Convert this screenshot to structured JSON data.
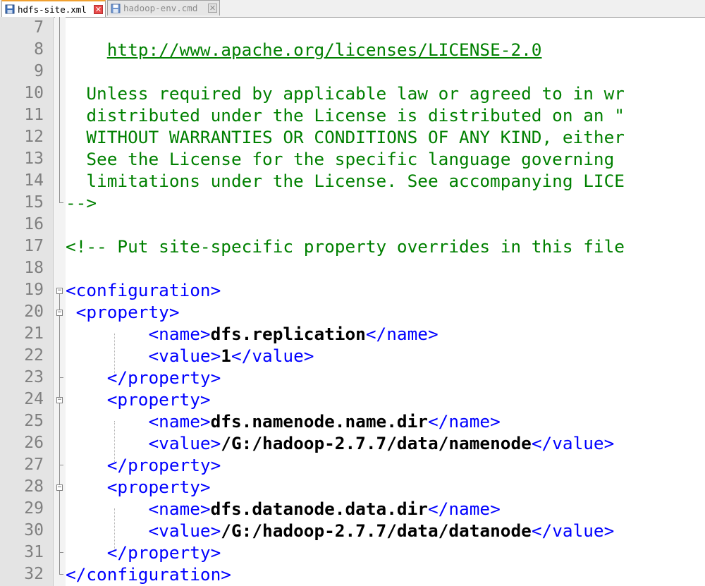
{
  "tabs": [
    {
      "name": "hdfs-site.xml",
      "active": true
    },
    {
      "name": "hadoop-env.cmd",
      "active": false
    }
  ],
  "colors": {
    "comment": "#008000",
    "tag": "#0000ff",
    "text": "#000000",
    "line_number": "#7f7f7f",
    "gutter_bg": "#e4e4e4"
  },
  "lines": [
    {
      "n": "7",
      "segs": []
    },
    {
      "n": "8",
      "segs": [
        {
          "c": "c",
          "t": "    "
        },
        {
          "c": "lnk",
          "t": "http://www.apache.org/licenses/LICENSE-2.0"
        }
      ]
    },
    {
      "n": "9",
      "segs": []
    },
    {
      "n": "10",
      "segs": [
        {
          "c": "c",
          "t": "  Unless required by applicable law or agreed to in wr"
        }
      ]
    },
    {
      "n": "11",
      "segs": [
        {
          "c": "c",
          "t": "  distributed under the License is distributed on an \""
        }
      ]
    },
    {
      "n": "12",
      "segs": [
        {
          "c": "c",
          "t": "  WITHOUT WARRANTIES OR CONDITIONS OF ANY KIND, either"
        }
      ]
    },
    {
      "n": "13",
      "segs": [
        {
          "c": "c",
          "t": "  See the License for the specific language governing"
        }
      ]
    },
    {
      "n": "14",
      "segs": [
        {
          "c": "c",
          "t": "  limitations under the License. See accompanying LICE"
        }
      ]
    },
    {
      "n": "15",
      "segs": [
        {
          "c": "c",
          "t": "-->"
        }
      ]
    },
    {
      "n": "16",
      "segs": []
    },
    {
      "n": "17",
      "segs": [
        {
          "c": "c",
          "t": "<!-- Put site-specific property overrides in this file"
        }
      ]
    },
    {
      "n": "18",
      "segs": []
    },
    {
      "n": "19",
      "segs": [
        {
          "c": "t",
          "t": "<configuration>"
        }
      ]
    },
    {
      "n": "20",
      "segs": [
        {
          "c": "t",
          "t": " <property>"
        }
      ]
    },
    {
      "n": "21",
      "segs": [
        {
          "c": "t",
          "t": "        <name>"
        },
        {
          "c": "b",
          "t": "dfs.replication"
        },
        {
          "c": "t",
          "t": "</name>"
        }
      ]
    },
    {
      "n": "22",
      "segs": [
        {
          "c": "t",
          "t": "        <value>"
        },
        {
          "c": "b",
          "t": "1"
        },
        {
          "c": "t",
          "t": "</value>"
        }
      ]
    },
    {
      "n": "23",
      "segs": [
        {
          "c": "t",
          "t": "    </property>"
        }
      ]
    },
    {
      "n": "24",
      "segs": [
        {
          "c": "t",
          "t": "    <property>"
        }
      ]
    },
    {
      "n": "25",
      "segs": [
        {
          "c": "t",
          "t": "        <name>"
        },
        {
          "c": "b",
          "t": "dfs.namenode.name.dir"
        },
        {
          "c": "t",
          "t": "</name>"
        }
      ]
    },
    {
      "n": "26",
      "segs": [
        {
          "c": "t",
          "t": "        <value>"
        },
        {
          "c": "b",
          "t": "/G:/hadoop-2.7.7/data/namenode"
        },
        {
          "c": "t",
          "t": "</value>"
        }
      ]
    },
    {
      "n": "27",
      "segs": [
        {
          "c": "t",
          "t": "    </property>"
        }
      ]
    },
    {
      "n": "28",
      "segs": [
        {
          "c": "t",
          "t": "    <property>"
        }
      ]
    },
    {
      "n": "29",
      "segs": [
        {
          "c": "t",
          "t": "        <name>"
        },
        {
          "c": "b",
          "t": "dfs.datanode.data.dir"
        },
        {
          "c": "t",
          "t": "</name>"
        }
      ]
    },
    {
      "n": "30",
      "segs": [
        {
          "c": "t",
          "t": "        <value>"
        },
        {
          "c": "b",
          "t": "/G:/hadoop-2.7.7/data/datanode"
        },
        {
          "c": "t",
          "t": "</value>"
        }
      ]
    },
    {
      "n": "31",
      "segs": [
        {
          "c": "t",
          "t": "    </property>"
        }
      ]
    },
    {
      "n": "32",
      "segs": [
        {
          "c": "t",
          "t": "</configuration>"
        }
      ]
    }
  ]
}
